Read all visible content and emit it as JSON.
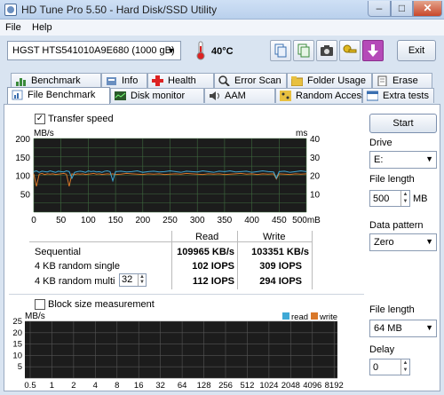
{
  "window": {
    "title": "HD Tune Pro 5.50 - Hard Disk/SSD Utility"
  },
  "menu": {
    "file": "File",
    "help": "Help"
  },
  "toolbar": {
    "drive": "HGST HTS541010A9E680 (1000 gB)",
    "temperature": "40°C",
    "exit": "Exit"
  },
  "tabs_row1": [
    {
      "label": "Benchmark",
      "icon": "benchmark-icon"
    },
    {
      "label": "Info",
      "icon": "info-icon"
    },
    {
      "label": "Health",
      "icon": "health-icon"
    },
    {
      "label": "Error Scan",
      "icon": "error-scan-icon"
    },
    {
      "label": "Folder Usage",
      "icon": "folder-icon"
    },
    {
      "label": "Erase",
      "icon": "erase-icon"
    }
  ],
  "tabs_row2": [
    {
      "label": "File Benchmark",
      "icon": "file-benchmark-icon",
      "active": true
    },
    {
      "label": "Disk monitor",
      "icon": "disk-monitor-icon"
    },
    {
      "label": "AAM",
      "icon": "aam-icon"
    },
    {
      "label": "Random Access",
      "icon": "random-access-icon"
    },
    {
      "label": "Extra tests",
      "icon": "extra-tests-icon"
    }
  ],
  "file_benchmark": {
    "transfer_speed_label": "Transfer speed",
    "transfer_speed_checked": true,
    "block_size_label": "Block size measurement",
    "block_size_checked": false,
    "results_header": {
      "read": "Read",
      "write": "Write"
    },
    "results": [
      {
        "label": "Sequential",
        "read": "109965 KB/s",
        "write": "103351 KB/s"
      },
      {
        "label": "4 KB random single",
        "read": "102 IOPS",
        "write": "309 IOPS"
      },
      {
        "label": "4 KB random multi",
        "read": "112 IOPS",
        "write": "294 IOPS"
      }
    ],
    "queue_depth": "32"
  },
  "controls": {
    "start": "Start",
    "drive_label": "Drive",
    "drive_value": "E:",
    "file_length_label": "File length",
    "file_length_value": "500",
    "file_length_unit": "MB",
    "data_pattern_label": "Data pattern",
    "data_pattern_value": "Zero",
    "file_length2_label": "File length",
    "file_length2_value": "64 MB",
    "delay_label": "Delay",
    "delay_value": "0"
  },
  "colors": {
    "read": "#3fa9d6",
    "write": "#d9782a",
    "chart_bg": "#1c1c1c",
    "grid": "#3f6b3f"
  },
  "chart_data": [
    {
      "type": "line",
      "title": "",
      "ylabel": "MB/s",
      "y2label": "ms",
      "xunit": "500mB",
      "x_ticks": [
        "0",
        "50",
        "100",
        "150",
        "200",
        "250",
        "300",
        "350",
        "400",
        "450",
        "500mB"
      ],
      "y_ticks": [
        "200",
        "150",
        "100",
        "50"
      ],
      "y2_ticks": [
        "40",
        "30",
        "20",
        "10"
      ],
      "xlim": [
        0,
        500
      ],
      "ylim": [
        0,
        200
      ],
      "y2lim": [
        0,
        40
      ],
      "grid": true,
      "series": [
        {
          "name": "read",
          "x": [
            0,
            5,
            10,
            15,
            20,
            25,
            30,
            35,
            40,
            45,
            50,
            55,
            60,
            65,
            70,
            75,
            80,
            85,
            90,
            95,
            100,
            105,
            110,
            115,
            120,
            125,
            130,
            135,
            140,
            145,
            150,
            160,
            170,
            180,
            190,
            200,
            210,
            220,
            230,
            240,
            250,
            260,
            270,
            280,
            290,
            300,
            310,
            320,
            330,
            340,
            350,
            360,
            370,
            380,
            390,
            400,
            410,
            420,
            430,
            440,
            445,
            450,
            460,
            470,
            480,
            490,
            500
          ],
          "values": [
            110,
            112,
            108,
            111,
            110,
            109,
            112,
            110,
            108,
            111,
            110,
            109,
            112,
            110,
            92,
            108,
            110,
            111,
            110,
            108,
            112,
            110,
            111,
            109,
            110,
            108,
            111,
            112,
            110,
            85,
            110,
            111,
            109,
            110,
            112,
            108,
            110,
            111,
            109,
            110,
            112,
            110,
            108,
            111,
            110,
            109,
            112,
            110,
            108,
            111,
            110,
            112,
            109,
            110,
            111,
            108,
            110,
            112,
            110,
            109,
            92,
            110,
            111,
            108,
            110,
            112,
            110
          ]
        },
        {
          "name": "write",
          "x": [
            0,
            5,
            10,
            15,
            20,
            25,
            30,
            35,
            40,
            45,
            50,
            55,
            60,
            65,
            70,
            75,
            80,
            85,
            90,
            95,
            100,
            105,
            110,
            115,
            120,
            125,
            130,
            135,
            140,
            145,
            150,
            160,
            170,
            180,
            190,
            200,
            210,
            220,
            230,
            240,
            250,
            260,
            270,
            280,
            290,
            300,
            310,
            320,
            330,
            340,
            350,
            360,
            370,
            380,
            390,
            400,
            410,
            420,
            430,
            440,
            445,
            450,
            460,
            470,
            480,
            490,
            500
          ],
          "values": [
            104,
            70,
            103,
            105,
            102,
            104,
            103,
            104,
            102,
            103,
            104,
            105,
            103,
            70,
            104,
            102,
            104,
            103,
            104,
            102,
            103,
            104,
            105,
            103,
            104,
            102,
            103,
            104,
            103,
            104,
            102,
            103,
            105,
            104,
            103,
            102,
            104,
            103,
            104,
            102,
            103,
            104,
            103,
            105,
            104,
            103,
            102,
            104,
            103,
            104,
            102,
            103,
            104,
            105,
            103,
            104,
            102,
            104,
            103,
            104,
            90,
            104,
            103,
            102,
            104,
            103,
            104
          ]
        }
      ]
    },
    {
      "type": "bar",
      "ylabel": "MB/s",
      "categories": [
        "0.5",
        "1",
        "2",
        "4",
        "8",
        "16",
        "32",
        "64",
        "128",
        "256",
        "512",
        "1024",
        "2048",
        "4096",
        "8192"
      ],
      "y_ticks": [
        "25",
        "20",
        "15",
        "10",
        "5"
      ],
      "ylim": [
        0,
        25
      ],
      "legend": [
        "read",
        "write"
      ],
      "legend_position": "top-right",
      "grid": true,
      "series": [
        {
          "name": "read",
          "values": []
        },
        {
          "name": "write",
          "values": []
        }
      ]
    }
  ]
}
